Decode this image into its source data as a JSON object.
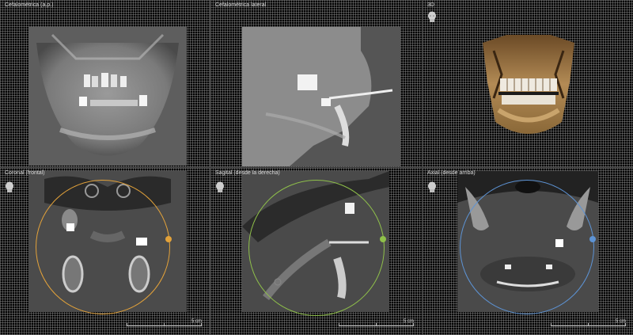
{
  "panels": {
    "ap": {
      "label": "Cefalométrica (a.p.)"
    },
    "lateral": {
      "label": "Cefalométrica lateral"
    },
    "view3d": {
      "label": "3D"
    },
    "coronal": {
      "label": "Coronal (frontal)",
      "scale": "5 cm",
      "accent": "#e3a23a"
    },
    "sagittal": {
      "label": "Sagital (desde la derecha)",
      "scale": "5 cm",
      "accent": "#8fc04a"
    },
    "axial": {
      "label": "Axial (desde arriba)",
      "scale": "5 cm",
      "accent": "#5d93d4"
    }
  },
  "icons": {
    "orientation": "head-orientation-icon"
  }
}
